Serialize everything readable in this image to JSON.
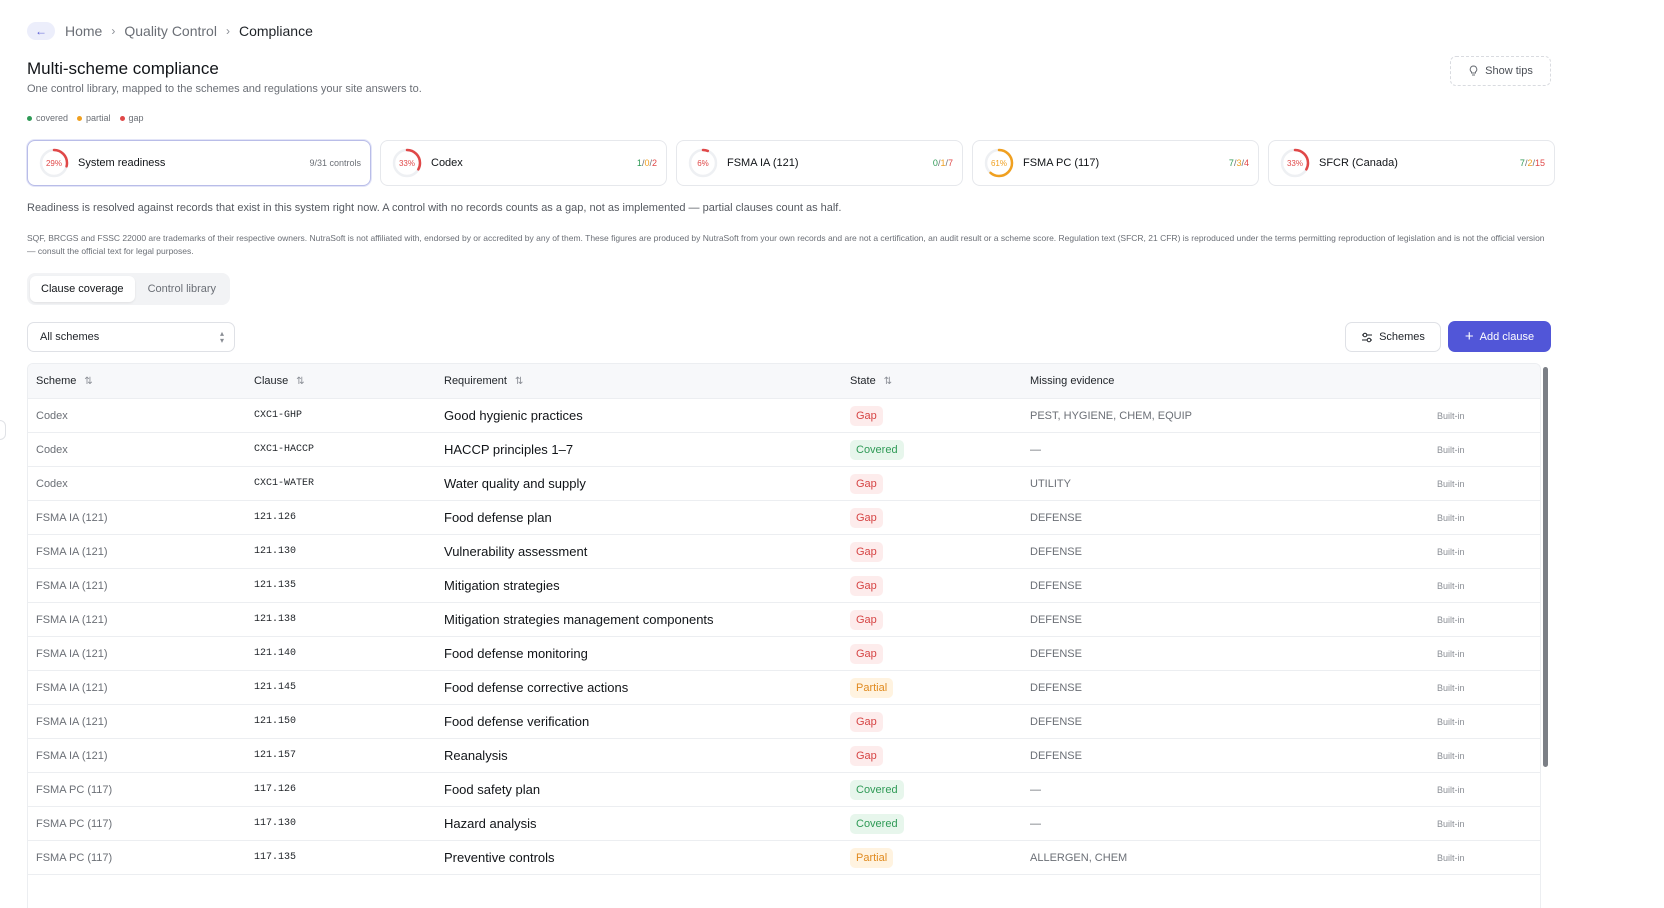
{
  "breadcrumb": {
    "items": [
      "Home",
      "Quality Control",
      "Compliance"
    ]
  },
  "header": {
    "title": "Multi-scheme compliance",
    "subtitle": "One control library, mapped to the schemes and regulations your site answers to.",
    "tips_label": "Show tips"
  },
  "legend": [
    {
      "label": "covered",
      "color": "#2f9a56"
    },
    {
      "label": "partial",
      "color": "#f0a020"
    },
    {
      "label": "gap",
      "color": "#e04848"
    }
  ],
  "cards": [
    {
      "pct": "29%",
      "pct_value": 29,
      "name": "System readiness",
      "count_text": "9/31 controls",
      "color": "#e04848"
    },
    {
      "pct": "33%",
      "pct_value": 33,
      "name": "Codex",
      "covered": "1",
      "partial": "0",
      "gap": "2",
      "color": "#e04848"
    },
    {
      "pct": "6%",
      "pct_value": 6,
      "name": "FSMA IA (121)",
      "covered": "0",
      "partial": "1",
      "gap": "7",
      "color": "#e04848"
    },
    {
      "pct": "61%",
      "pct_value": 61,
      "name": "FSMA PC (117)",
      "covered": "7",
      "partial": "3",
      "gap": "4",
      "color": "#f0a020"
    },
    {
      "pct": "33%",
      "pct_value": 33,
      "name": "SFCR (Canada)",
      "covered": "7",
      "partial": "2",
      "gap": "15",
      "color": "#e04848"
    }
  ],
  "note": "Readiness is resolved against records that exist in this system right now. A control with no records counts as a gap, not as implemented — partial clauses count as half.",
  "disclaimer": "SQF, BRCGS and FSSC 22000 are trademarks of their respective owners. NutraSoft is not affiliated with, endorsed by or accredited by any of them. These figures are produced by NutraSoft from your own records and are not a certification, an audit result or a scheme score. Regulation text (SFCR, 21 CFR) is reproduced under the terms permitting reproduction of legislation and is not the official version — consult the official text for legal purposes.",
  "tabs": [
    "Clause coverage",
    "Control library"
  ],
  "filter": {
    "value": "All schemes"
  },
  "toolbar": {
    "schemes_label": "Schemes",
    "add_label": "Add clause"
  },
  "table": {
    "headers": {
      "scheme": "Scheme",
      "clause": "Clause",
      "requirement": "Requirement",
      "state": "State",
      "missing": "Missing evidence"
    },
    "rows": [
      {
        "scheme": "Codex",
        "clause": "CXC1-GHP",
        "requirement": "Good hygienic practices",
        "state": "Gap",
        "missing": "PEST, HYGIENE, CHEM, EQUIP",
        "source": "Built-in"
      },
      {
        "scheme": "Codex",
        "clause": "CXC1-HACCP",
        "requirement": "HACCP principles 1–7",
        "state": "Covered",
        "missing": "—",
        "source": "Built-in"
      },
      {
        "scheme": "Codex",
        "clause": "CXC1-WATER",
        "requirement": "Water quality and supply",
        "state": "Gap",
        "missing": "UTILITY",
        "source": "Built-in"
      },
      {
        "scheme": "FSMA IA (121)",
        "clause": "121.126",
        "requirement": "Food defense plan",
        "state": "Gap",
        "missing": "DEFENSE",
        "source": "Built-in"
      },
      {
        "scheme": "FSMA IA (121)",
        "clause": "121.130",
        "requirement": "Vulnerability assessment",
        "state": "Gap",
        "missing": "DEFENSE",
        "source": "Built-in"
      },
      {
        "scheme": "FSMA IA (121)",
        "clause": "121.135",
        "requirement": "Mitigation strategies",
        "state": "Gap",
        "missing": "DEFENSE",
        "source": "Built-in"
      },
      {
        "scheme": "FSMA IA (121)",
        "clause": "121.138",
        "requirement": "Mitigation strategies management components",
        "state": "Gap",
        "missing": "DEFENSE",
        "source": "Built-in"
      },
      {
        "scheme": "FSMA IA (121)",
        "clause": "121.140",
        "requirement": "Food defense monitoring",
        "state": "Gap",
        "missing": "DEFENSE",
        "source": "Built-in"
      },
      {
        "scheme": "FSMA IA (121)",
        "clause": "121.145",
        "requirement": "Food defense corrective actions",
        "state": "Partial",
        "missing": "DEFENSE",
        "source": "Built-in"
      },
      {
        "scheme": "FSMA IA (121)",
        "clause": "121.150",
        "requirement": "Food defense verification",
        "state": "Gap",
        "missing": "DEFENSE",
        "source": "Built-in"
      },
      {
        "scheme": "FSMA IA (121)",
        "clause": "121.157",
        "requirement": "Reanalysis",
        "state": "Gap",
        "missing": "DEFENSE",
        "source": "Built-in"
      },
      {
        "scheme": "FSMA PC (117)",
        "clause": "117.126",
        "requirement": "Food safety plan",
        "state": "Covered",
        "missing": "—",
        "source": "Built-in"
      },
      {
        "scheme": "FSMA PC (117)",
        "clause": "117.130",
        "requirement": "Hazard analysis",
        "state": "Covered",
        "missing": "—",
        "source": "Built-in"
      },
      {
        "scheme": "FSMA PC (117)",
        "clause": "117.135",
        "requirement": "Preventive controls",
        "state": "Partial",
        "missing": "ALLERGEN, CHEM",
        "source": "Built-in"
      }
    ]
  }
}
